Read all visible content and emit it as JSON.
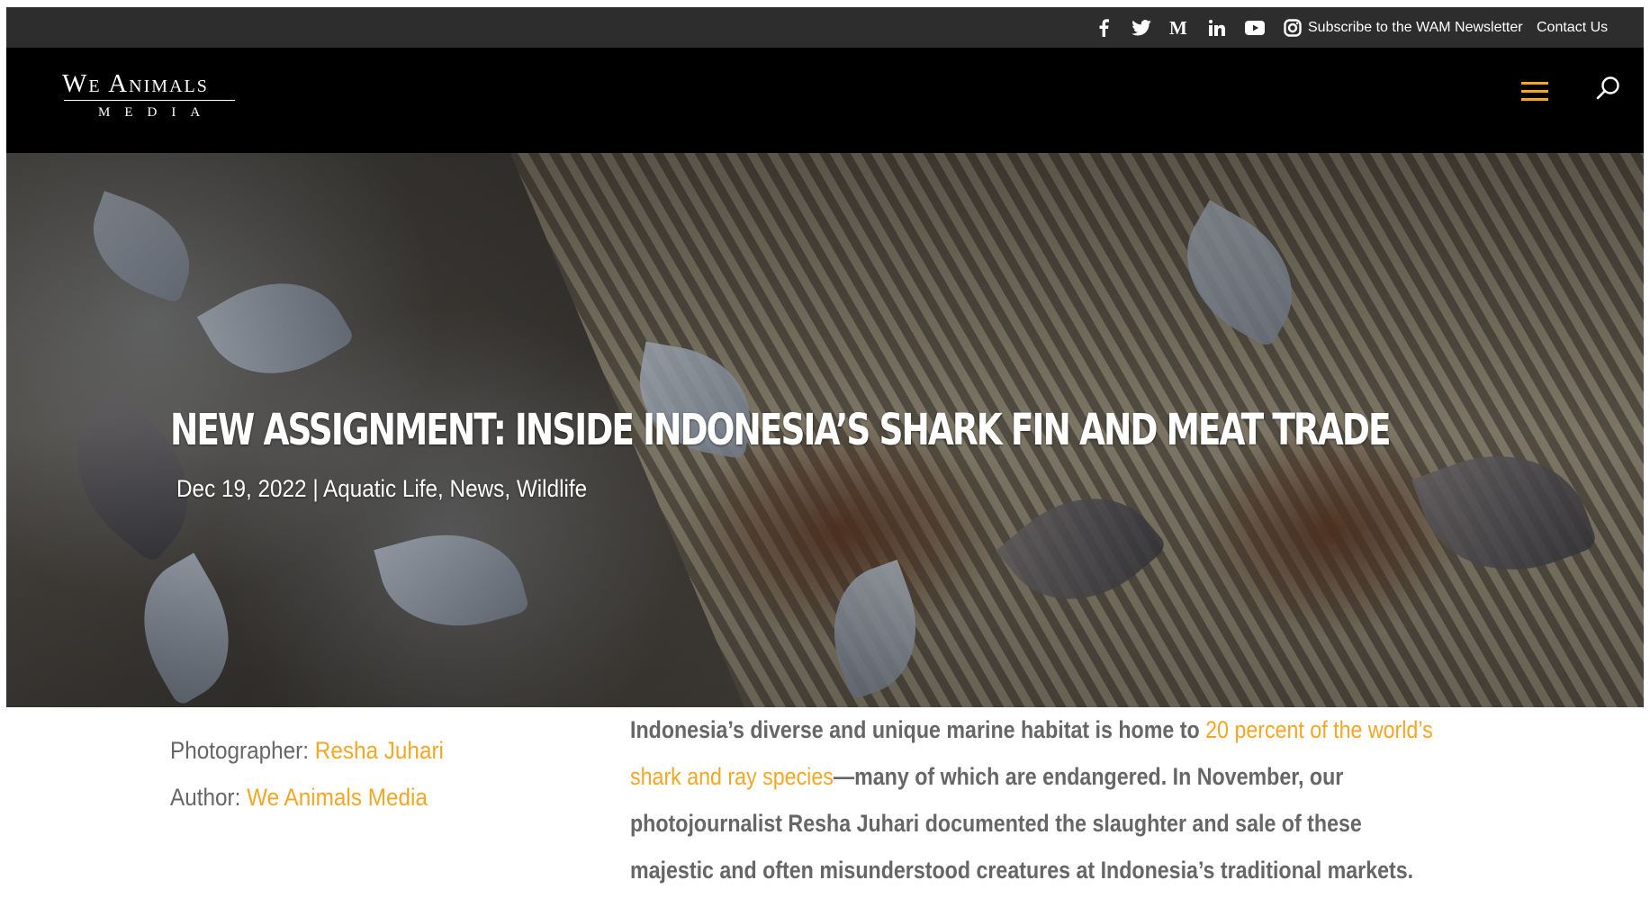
{
  "topbar": {
    "social_icons": [
      "facebook-icon",
      "twitter-icon",
      "medium-icon",
      "linkedin-icon",
      "youtube-icon",
      "instagram-icon"
    ],
    "newsletter_label": "Subscribe to the WAM Newsletter",
    "contact_label": "Contact Us"
  },
  "navbar": {
    "logo_main": "We Animals",
    "logo_sub": "MEDIA",
    "menu_icon": "hamburger-icon",
    "search_icon": "search-icon",
    "accent_color": "#f5a623"
  },
  "hero": {
    "title": "NEW ASSIGNMENT: INSIDE INDONESIA’S SHARK FIN AND MEAT TRADE",
    "date": "Dec 19, 2022",
    "separator": "|",
    "categories": [
      "Aquatic Life",
      "News",
      "Wildlife"
    ]
  },
  "credits": {
    "photographer_label": "Photographer:",
    "photographer_name": "Resha Juhari",
    "author_label": "Author:",
    "author_name": "We Animals Media"
  },
  "intro": {
    "text_before": "Indonesia’s diverse and unique marine habitat is home to ",
    "link_text": "20 percent of the world’s shark and ray species",
    "text_after": "—many of which are endangered. In November, our photojournalist Resha Juhari documented the slaughter and sale of these majestic and often misunderstood creatures at Indonesia’s traditional markets."
  }
}
